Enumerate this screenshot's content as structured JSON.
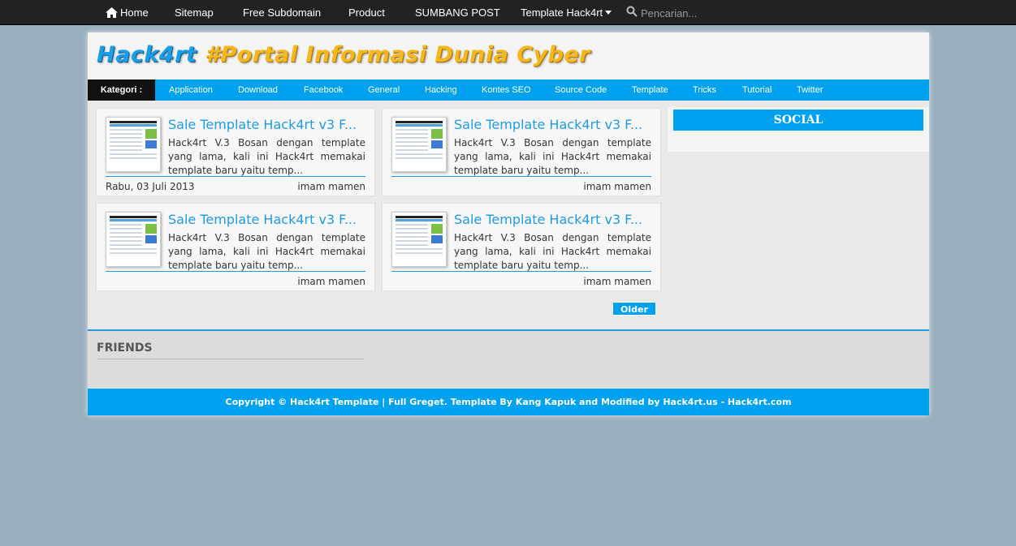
{
  "topnav": {
    "items": [
      {
        "label": "Home",
        "icon": "home-icon"
      },
      {
        "label": "Sitemap"
      },
      {
        "label": "Free Subdomain"
      },
      {
        "label": "Product"
      },
      {
        "label": "SUMBANG POST"
      },
      {
        "label": "Template Hack4rt"
      }
    ],
    "search_placeholder": "Pencarian..."
  },
  "header": {
    "title_part1": "Hack4rt",
    "title_part2": "#Portal Informasi Dunia Cyber"
  },
  "categories": {
    "label": "Kategori :",
    "items": [
      "Application",
      "Download",
      "Facebook",
      "General",
      "Hacking",
      "Kontes SEO",
      "Source Code",
      "Template",
      "Tricks",
      "Tutorial",
      "Twitter"
    ]
  },
  "posts": [
    {
      "title": "Sale Template Hack4rt v3 F...",
      "excerpt": "Hack4rt V.3 Bosan dengan template yang lama, kali ini Hack4rt memakai template baru yaitu temp...",
      "date": "Rabu, 03 Juli 2013",
      "author": "imam mamen"
    },
    {
      "title": "Sale Template Hack4rt v3 F...",
      "excerpt": "Hack4rt V.3 Bosan dengan template yang lama, kali ini Hack4rt memakai template baru yaitu temp...",
      "date": "",
      "author": "imam mamen"
    },
    {
      "title": "Sale Template Hack4rt v3 F...",
      "excerpt": "Hack4rt V.3 Bosan dengan template yang lama, kali ini Hack4rt memakai template baru yaitu temp...",
      "date": "",
      "author": "imam mamen"
    },
    {
      "title": "Sale Template Hack4rt v3 F...",
      "excerpt": "Hack4rt V.3 Bosan dengan template yang lama, kali ini Hack4rt memakai template baru yaitu temp...",
      "date": "",
      "author": "imam mamen"
    }
  ],
  "pager": {
    "older_label": "Older"
  },
  "sidebar": {
    "social_title": "SOCIAL"
  },
  "friends": {
    "title": "FRIENDS"
  },
  "footer": {
    "text": "Copyright © Hack4rt Template | Full Greget. Template By Kang Kapuk and Modified by Hack4rt.us - Hack4rt.com"
  },
  "colors": {
    "accent": "#00a2f0",
    "link": "#1e9be4",
    "title_blue": "#1b9ee8",
    "title_gold": "#f5b81c",
    "nav_bg": "#222222",
    "page_bg": "#9aafbd"
  }
}
